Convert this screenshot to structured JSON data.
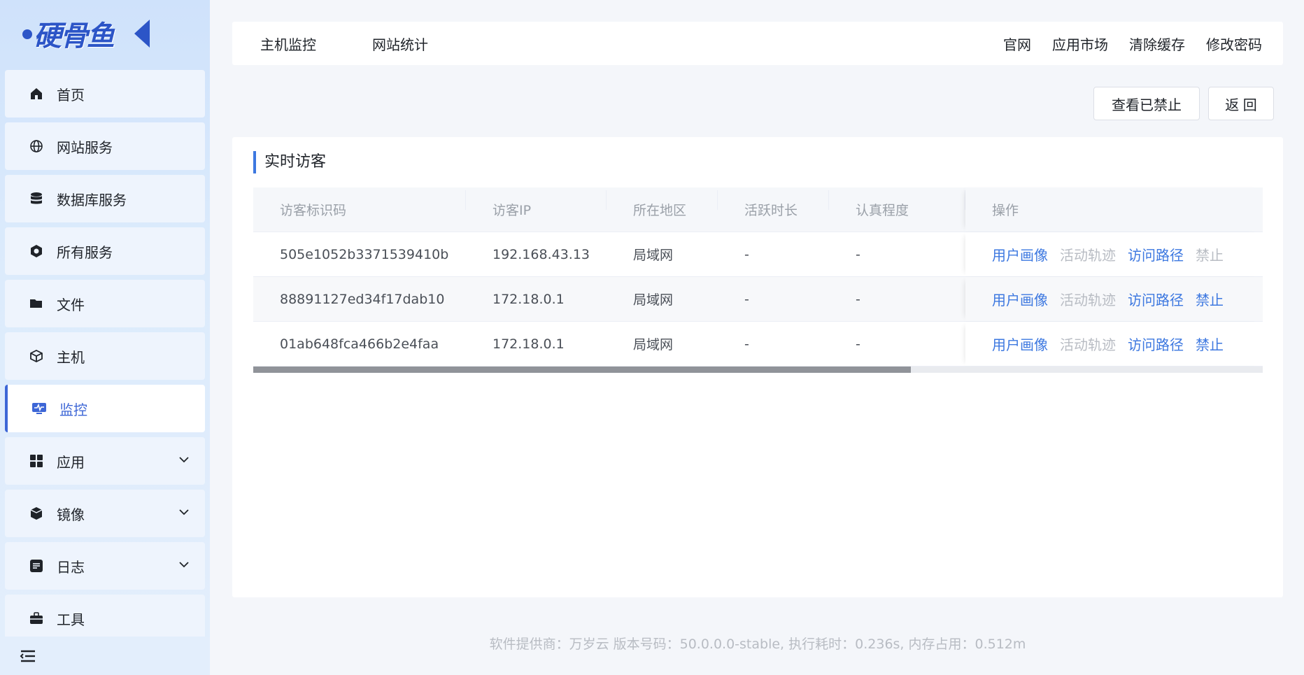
{
  "brand": {
    "logo_text": "硬骨鱼"
  },
  "sidebar": {
    "items": [
      {
        "label": "首页",
        "icon": "home-icon"
      },
      {
        "label": "网站服务",
        "icon": "globe-icon"
      },
      {
        "label": "数据库服务",
        "icon": "database-icon"
      },
      {
        "label": "所有服务",
        "icon": "services-icon"
      },
      {
        "label": "文件",
        "icon": "folder-icon"
      },
      {
        "label": "主机",
        "icon": "host-icon"
      },
      {
        "label": "监控",
        "icon": "monitor-icon",
        "active": true
      },
      {
        "label": "应用",
        "icon": "apps-grid-icon",
        "expandable": true
      },
      {
        "label": "镜像",
        "icon": "image-box-icon",
        "expandable": true
      },
      {
        "label": "日志",
        "icon": "log-icon",
        "expandable": true
      },
      {
        "label": "工具",
        "icon": "toolbox-icon"
      }
    ],
    "collapse_icon": "collapse-menu-icon"
  },
  "topbar": {
    "left": [
      "主机监控",
      "网站统计"
    ],
    "right": [
      "官网",
      "应用市场",
      "清除缓存",
      "修改密码"
    ]
  },
  "actions": {
    "view_banned": "查看已禁止",
    "back": "返 回"
  },
  "panel": {
    "title": "实时访客",
    "columns": [
      "访客标识码",
      "访客IP",
      "所在地区",
      "活跃时长",
      "认真程度",
      "操作"
    ],
    "rows": [
      {
        "id": "505e1052b3371539410b",
        "ip": "192.168.43.13",
        "region": "局域网",
        "duration": "-",
        "seriousness": "-",
        "ops": [
          "用户画像",
          "活动轨迹",
          "访问路径",
          "禁止"
        ],
        "ban_disabled": true
      },
      {
        "id": "88891127ed34f17dab10",
        "ip": "172.18.0.1",
        "region": "局域网",
        "duration": "-",
        "seriousness": "-",
        "ops": [
          "用户画像",
          "活动轨迹",
          "访问路径",
          "禁止"
        ],
        "ban_disabled": false
      },
      {
        "id": "01ab648fca466b2e4faa",
        "ip": "172.18.0.1",
        "region": "局域网",
        "duration": "-",
        "seriousness": "-",
        "ops": [
          "用户画像",
          "活动轨迹",
          "访问路径",
          "禁止"
        ],
        "ban_disabled": false
      }
    ],
    "horizontal_scroll_position": 0.0
  },
  "footer": {
    "text": "软件提供商：万岁云    版本号码：50.0.0.0-stable, 执行耗时：0.236s, 内存占用：0.512m"
  },
  "colors": {
    "accent": "#3d78e0",
    "sidebar_bg": "#cfe2fb",
    "muted": "#b8bcc3"
  }
}
